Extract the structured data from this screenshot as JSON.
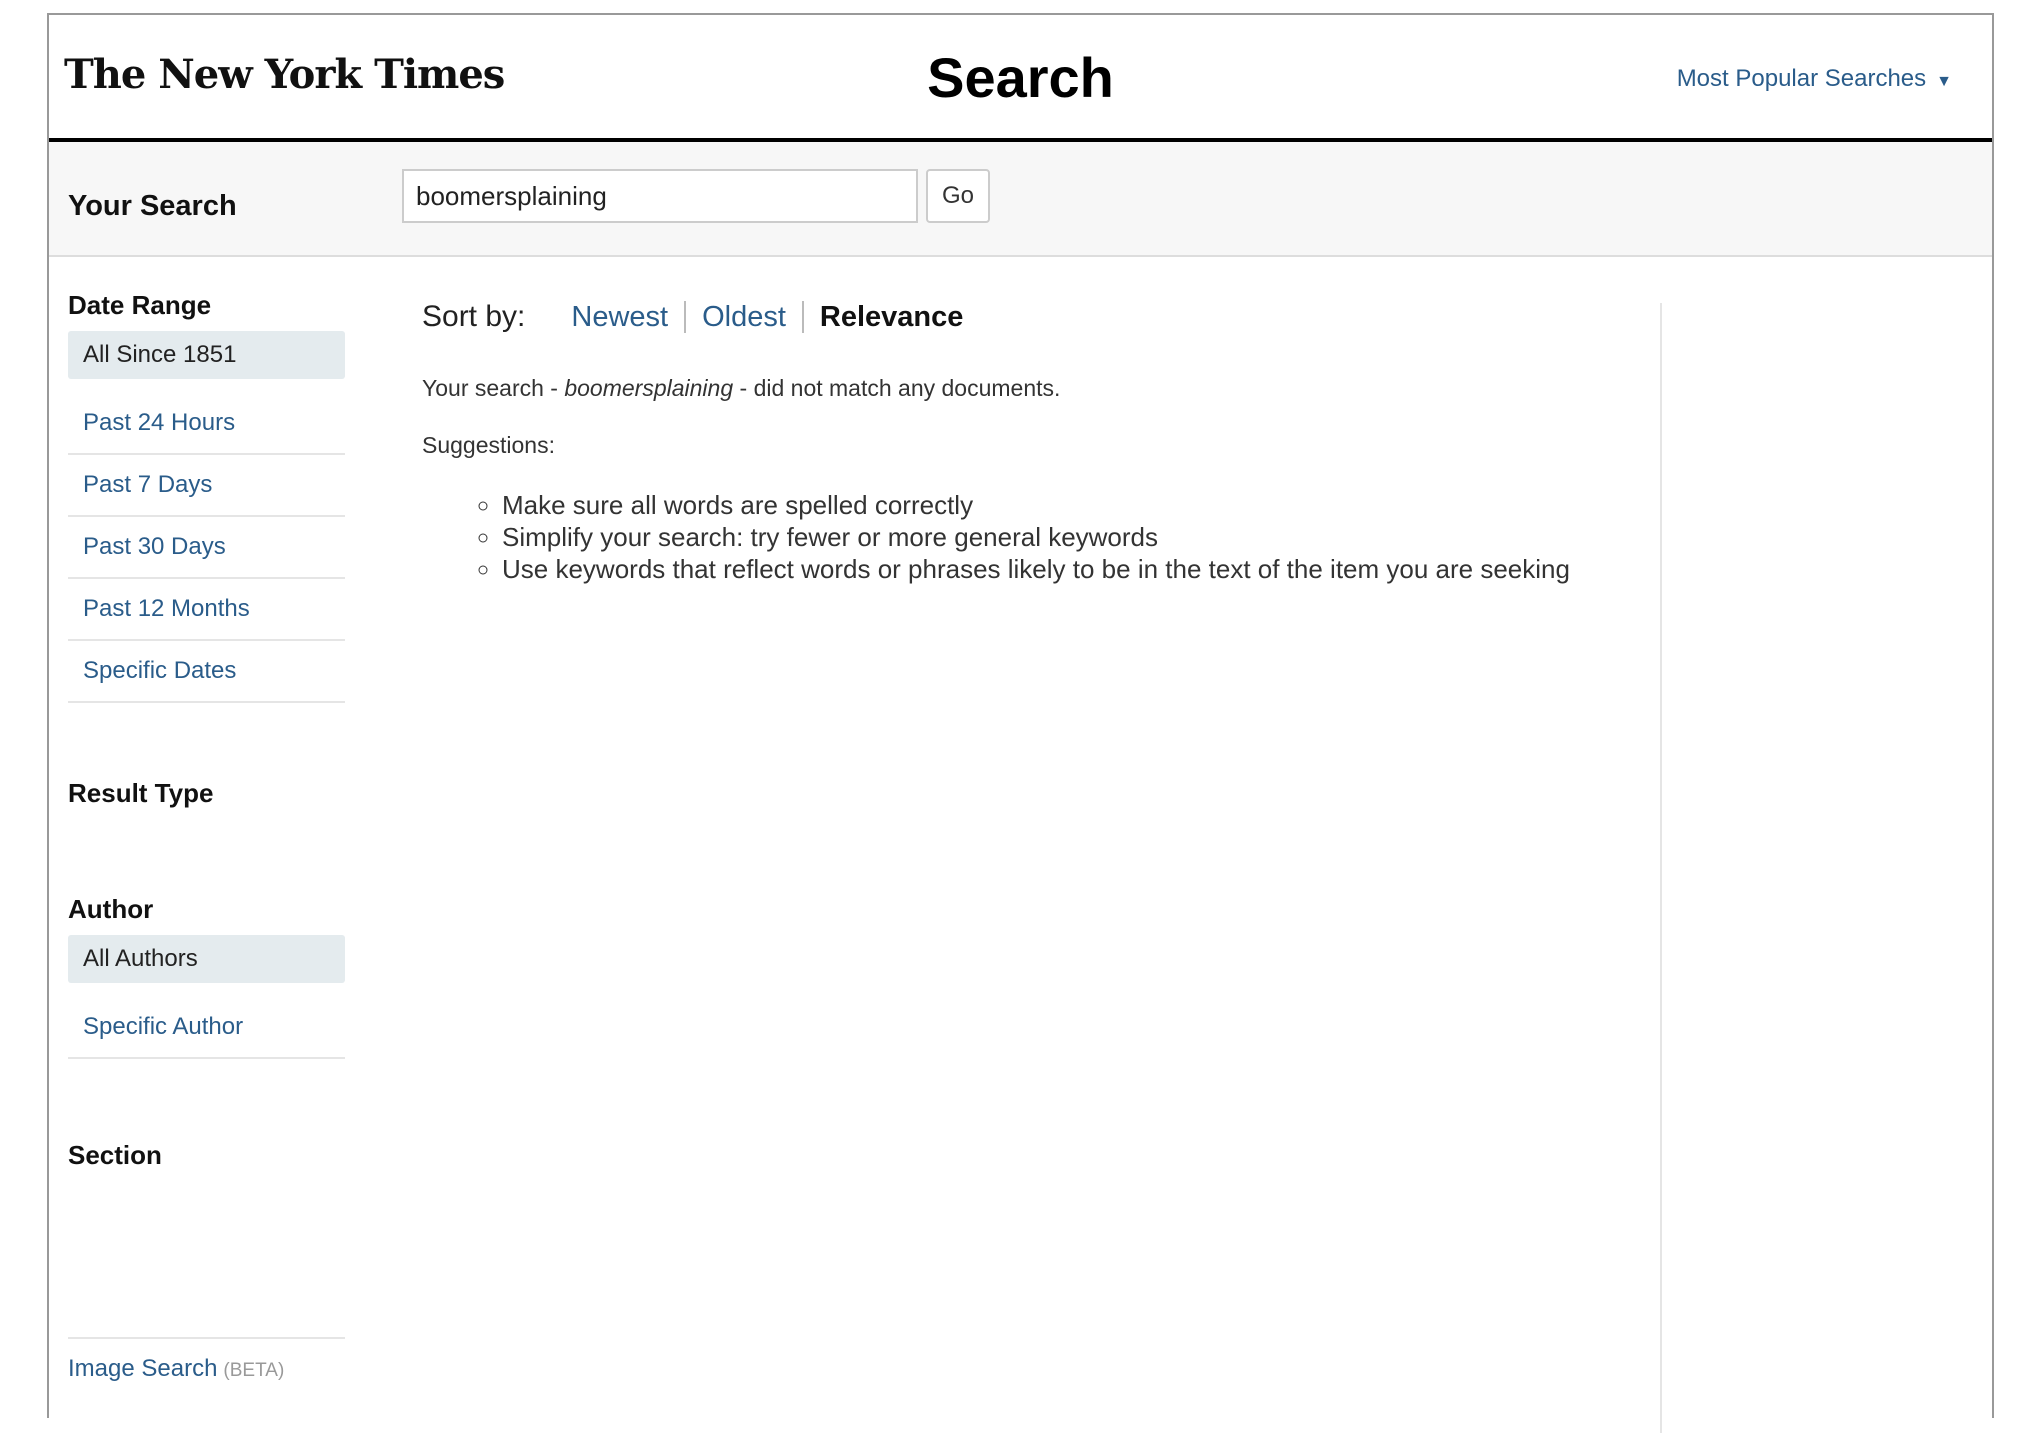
{
  "masthead": {
    "logo_text": "The New York Times",
    "title": "Search",
    "popular_label": "Most Popular Searches",
    "popular_caret": "▼"
  },
  "searchbar": {
    "label": "Your Search",
    "query": "boomersplaining",
    "go_label": "Go"
  },
  "sidebar": {
    "date_range": {
      "title": "Date Range",
      "items": [
        "All Since 1851",
        "Past 24 Hours",
        "Past 7 Days",
        "Past 30 Days",
        "Past 12 Months",
        "Specific Dates"
      ],
      "selected": "All Since 1851"
    },
    "result_type": {
      "title": "Result Type"
    },
    "author": {
      "title": "Author",
      "items": [
        "All Authors",
        "Specific Author"
      ],
      "selected": "All Authors"
    },
    "section": {
      "title": "Section"
    },
    "image_search": {
      "label": "Image Search",
      "badge": "(BETA)"
    }
  },
  "main": {
    "sort": {
      "label": "Sort by:",
      "options": [
        "Newest",
        "Oldest",
        "Relevance"
      ],
      "active": "Relevance"
    },
    "message": {
      "prefix": "Your search - ",
      "term": "boomersplaining",
      "suffix": " - did not match any documents."
    },
    "suggestions_label": "Suggestions:",
    "suggestions": [
      "Make sure all words are spelled correctly",
      "Simplify your search: try fewer or more general keywords",
      "Use keywords that reflect words or phrases likely to be in the text of the item you are seeking"
    ]
  },
  "colors": {
    "link": "#2a5c8a",
    "selected_bg": "#e4ebee",
    "rule": "#000000"
  }
}
